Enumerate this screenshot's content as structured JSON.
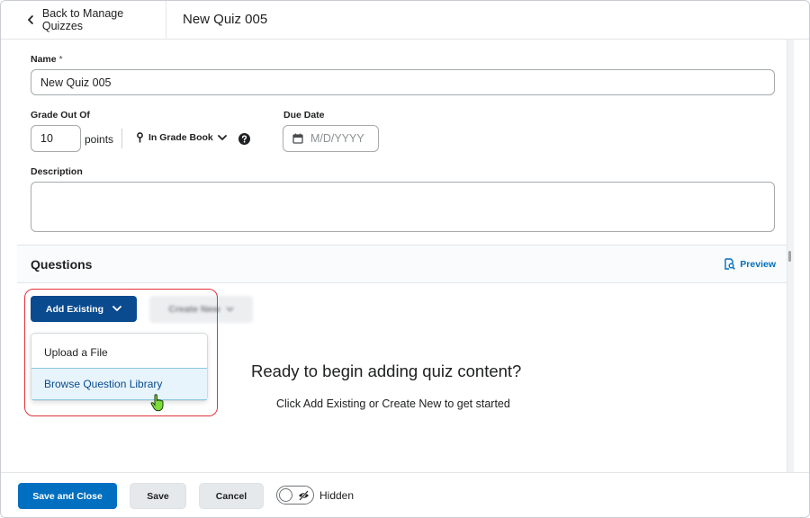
{
  "header": {
    "back_label": "Back to Manage Quizzes",
    "title": "New Quiz 005"
  },
  "form": {
    "name_label": "Name",
    "name_required_mark": "*",
    "name_value": "New Quiz 005",
    "grade_label": "Grade Out Of",
    "grade_value": "10",
    "points_label": "points",
    "gradebook_label": "In Grade Book",
    "due_date_label": "Due Date",
    "due_date_placeholder": "M/D/YYYY",
    "description_label": "Description",
    "description_value": ""
  },
  "questions": {
    "title": "Questions",
    "preview_label": "Preview",
    "add_existing_label": "Add Existing",
    "create_new_label": "Create New",
    "dropdown_items": [
      {
        "label": "Upload a File"
      },
      {
        "label": "Browse Question Library"
      }
    ],
    "empty_title": "Ready to begin adding quiz content?",
    "empty_subtitle": "Click Add Existing or Create New to get started"
  },
  "footer": {
    "save_close_label": "Save and Close",
    "save_label": "Save",
    "cancel_label": "Cancel",
    "visibility_label": "Hidden"
  },
  "colors": {
    "primary": "#0a4a8f",
    "link": "#006fbf",
    "highlight": "#e0353b",
    "selected_bg": "#e7f4fb"
  },
  "icons": {
    "back": "chevron-left-icon",
    "gradebook": "map-pin-icon",
    "gradebook_toggle": "chevron-down-icon",
    "help": "help-circle-icon",
    "due_date": "calendar-icon",
    "preview": "preview-icon",
    "add_existing_toggle": "chevron-down-icon",
    "visibility": "eye-slash-icon",
    "cursor": "hand-cursor-icon"
  }
}
